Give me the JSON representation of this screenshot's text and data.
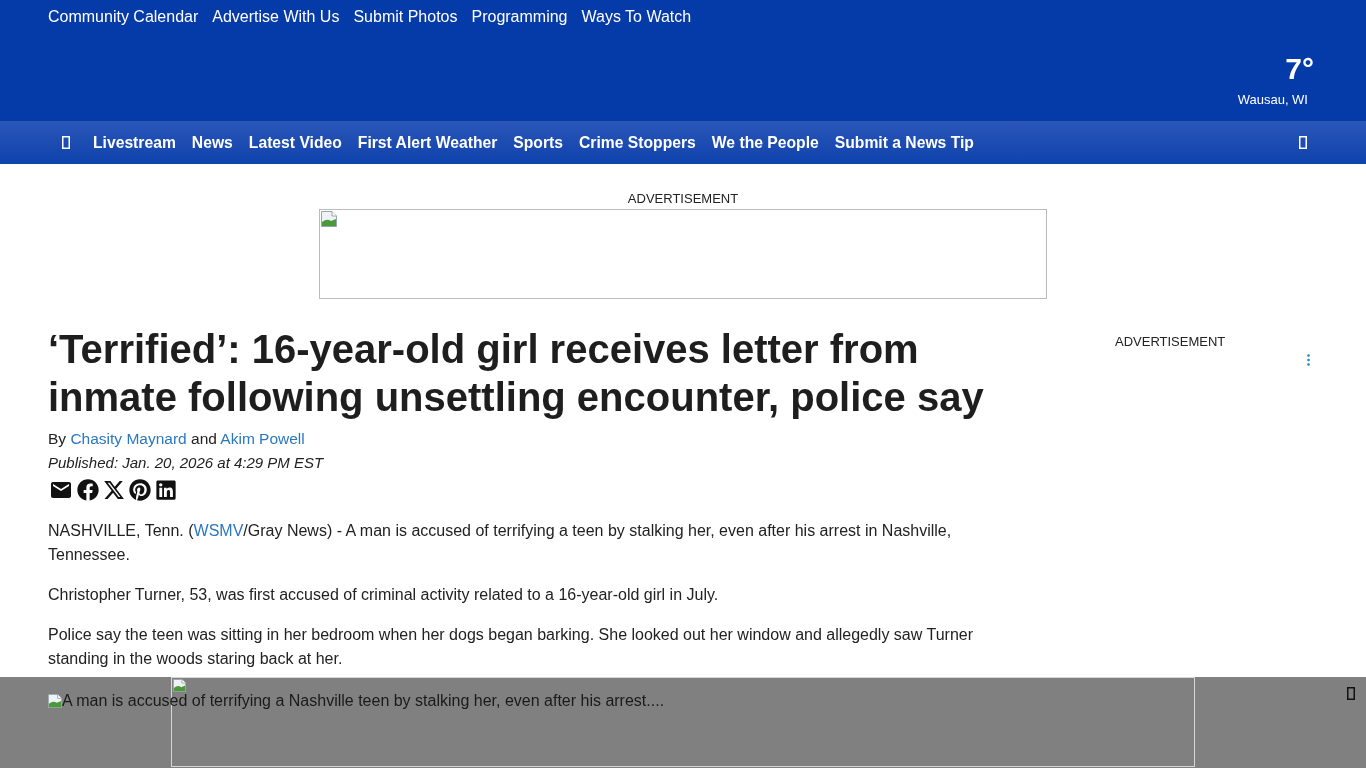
{
  "top_links": [
    {
      "label": "Community Calendar"
    },
    {
      "label": "Advertise With Us"
    },
    {
      "label": "Submit Photos"
    },
    {
      "label": "Programming"
    },
    {
      "label": "Ways To Watch"
    }
  ],
  "weather": {
    "temperature": "7°",
    "location": "Wausau, WI"
  },
  "nav": {
    "items": [
      "Livestream",
      "News",
      "Latest Video",
      "First Alert Weather",
      "Sports",
      "Crime Stoppers",
      "We the People",
      "Submit a News Tip"
    ]
  },
  "top_ad": {
    "label": "ADVERTISEMENT"
  },
  "article": {
    "headline": "‘Terrified’: 16-year-old girl receives letter from inmate following unsettling encounter, police say",
    "byline": {
      "prefix": "By",
      "authors": [
        "Chasity Maynard",
        "Akim Powell"
      ],
      "joiner": "and"
    },
    "published": "Published: Jan. 20, 2026 at 4:29 PM EST",
    "paragraphs": [
      {
        "kind": "linked",
        "before": "NASHVILLE, Tenn. (",
        "link": "WSMV",
        "after": "/Gray News) - A man is accused of terrifying a teen by stalking her, even after his arrest in Nashville, Tennessee."
      },
      {
        "kind": "plain",
        "text": "Christopher Turner, 53, was first accused of criminal activity related to a 16-year-old girl in July."
      },
      {
        "kind": "plain",
        "text": "Police say the teen was sitting in her bedroom when her dogs began barking. She looked out her window and allegedly saw Turner standing in the woods staring back at her."
      }
    ]
  },
  "sidebar_ad": {
    "label": "ADVERTISEMENT"
  },
  "sticky_ad": {
    "alt_text": "A man is accused of terrifying a Nashville teen by stalking her, even after his arrest...."
  }
}
